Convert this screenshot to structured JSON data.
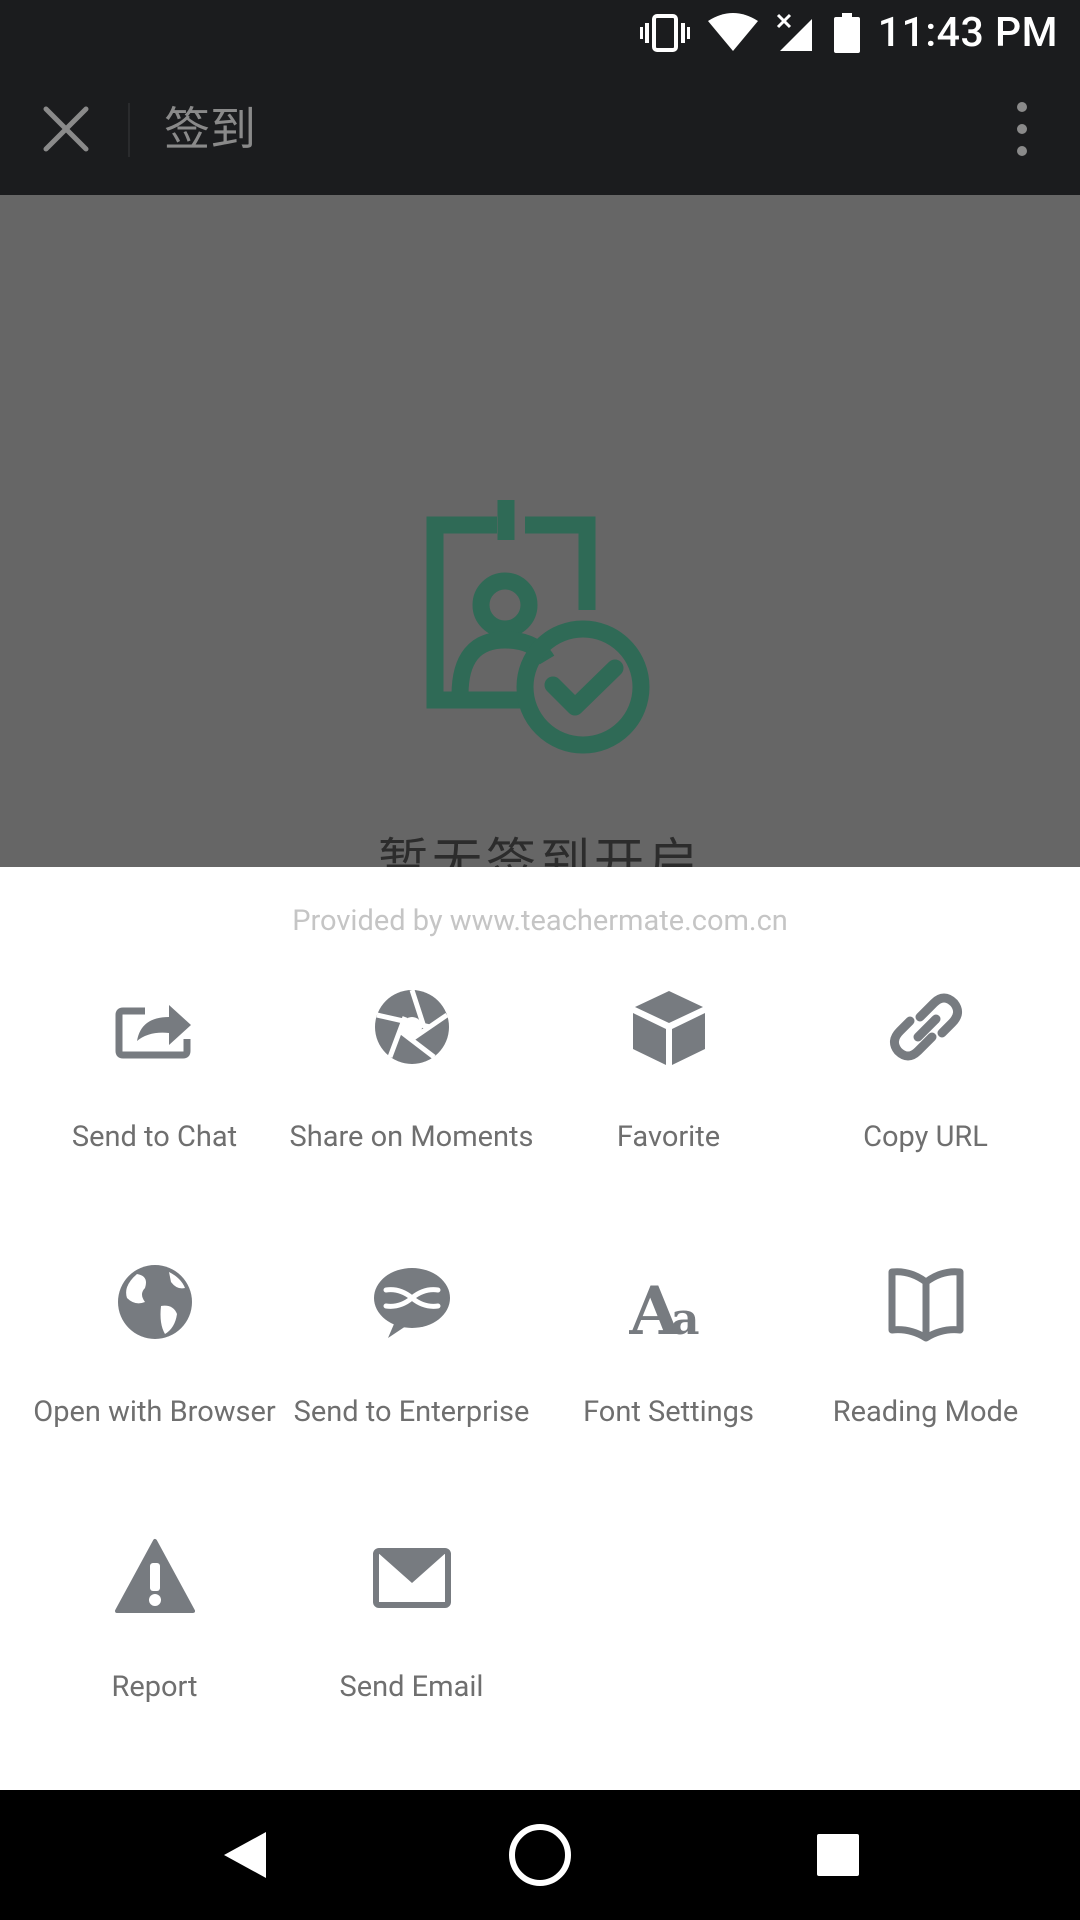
{
  "status_bar": {
    "time": "11:43 PM",
    "icons": [
      "vibrate-icon",
      "wifi-icon",
      "cellular-no-signal-icon",
      "battery-icon"
    ]
  },
  "title_bar": {
    "title": "签到",
    "close_icon": "close-icon",
    "more_icon": "more-vertical-icon"
  },
  "web_content": {
    "empty_text": "暂无签到开启",
    "accent_color": "#2f6a56",
    "overlay_color": "#666666"
  },
  "sheet": {
    "provider": "Provided by www.teachermate.com.cn",
    "items": [
      {
        "label": "Send to Chat",
        "icon": "share-arrow-icon"
      },
      {
        "label": "Share on Moments",
        "icon": "aperture-icon"
      },
      {
        "label": "Favorite",
        "icon": "cube-icon"
      },
      {
        "label": "Copy URL",
        "icon": "link-icon"
      },
      {
        "label": "Open with Browser",
        "icon": "globe-icon"
      },
      {
        "label": "Send to Enterprise",
        "icon": "enterprise-chat-icon"
      },
      {
        "label": "Font Settings",
        "icon": "font-aa-icon"
      },
      {
        "label": "Reading Mode",
        "icon": "open-book-icon"
      },
      {
        "label": "Report",
        "icon": "warning-icon"
      },
      {
        "label": "Send Email",
        "icon": "envelope-icon"
      }
    ],
    "icon_color": "#777b80",
    "label_color": "#6f6f6f"
  },
  "nav_bar": {
    "buttons": [
      "back-triangle-icon",
      "home-circle-icon",
      "recents-square-icon"
    ]
  }
}
